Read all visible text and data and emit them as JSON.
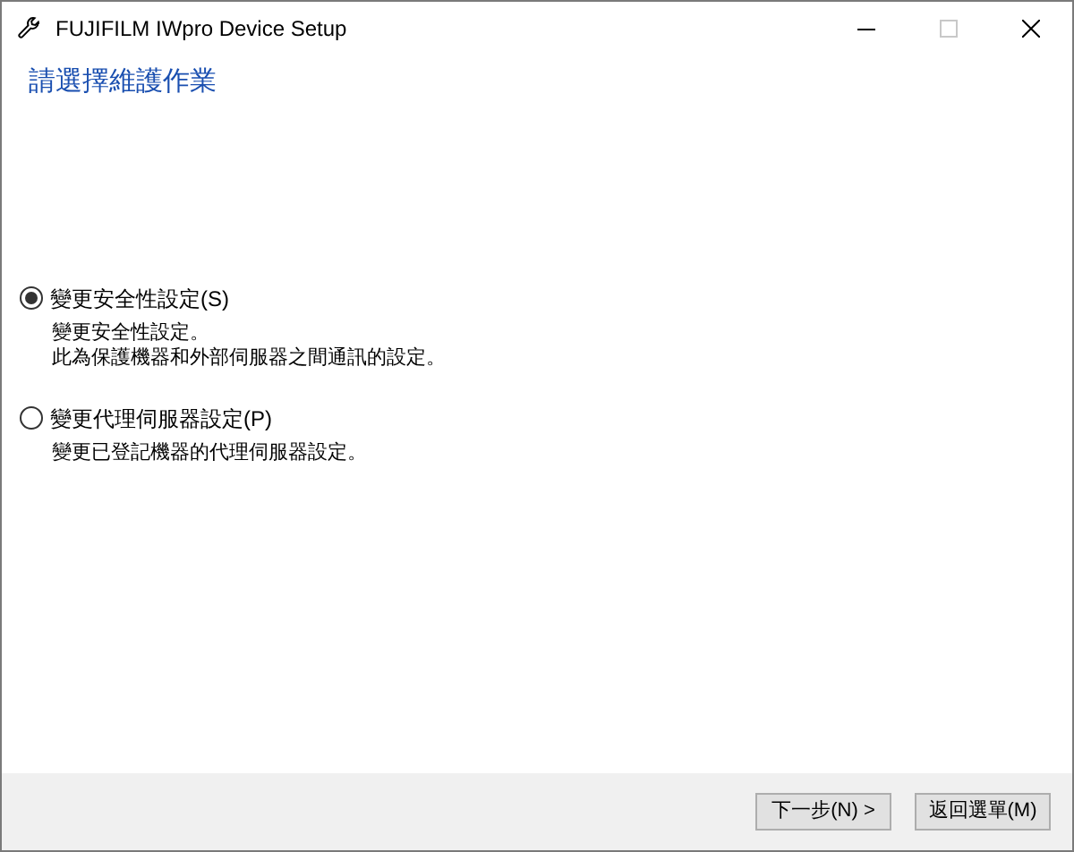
{
  "window": {
    "title": "FUJIFILM IWpro Device Setup",
    "controls": [
      {
        "kind": "minimize",
        "disabled": false
      },
      {
        "kind": "maximize",
        "disabled": true
      },
      {
        "kind": "close",
        "disabled": false
      }
    ]
  },
  "heading": "請選擇維護作業",
  "options": [
    {
      "label": "變更安全性設定(S)",
      "selected": true,
      "description": [
        "變更安全性設定。",
        "此為保護機器和外部伺服器之間通訊的設定。"
      ]
    },
    {
      "label": "變更代理伺服器設定(P)",
      "selected": false,
      "description": [
        "變更已登記機器的代理伺服器設定。"
      ]
    }
  ],
  "buttons": [
    "下一步(N) >",
    "返回選單(M)"
  ]
}
